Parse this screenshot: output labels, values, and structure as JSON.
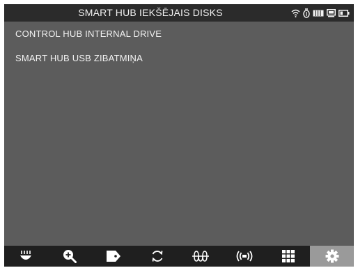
{
  "header": {
    "title": "SMART HUB IEKŠĒJAIS DISKS",
    "status_icons": [
      "wifi-icon",
      "bluetooth-icon",
      "brick-battery-icon",
      "screen-icon",
      "battery-icon"
    ]
  },
  "drive_list": {
    "items": [
      {
        "label": "CONTROL HUB INTERNAL DRIVE"
      },
      {
        "label": "SMART HUB USB ZIBATMIŅA"
      }
    ]
  },
  "toolbar": {
    "buttons": [
      {
        "icon": "sensor-icon"
      },
      {
        "icon": "zoom-in-icon"
      },
      {
        "icon": "tag-icon"
      },
      {
        "icon": "sync-icon"
      },
      {
        "icon": "waveform-icon"
      },
      {
        "icon": "broadcast-icon"
      },
      {
        "icon": "grid-icon"
      },
      {
        "icon": "settings-gear-icon",
        "active": true
      }
    ]
  },
  "colors": {
    "titlebar": "#2b2b2b",
    "background": "#5c5c5c",
    "toolbar": "#1f1f1f",
    "active_tab": "#9a9a9a",
    "text": "#f2f2f2"
  }
}
